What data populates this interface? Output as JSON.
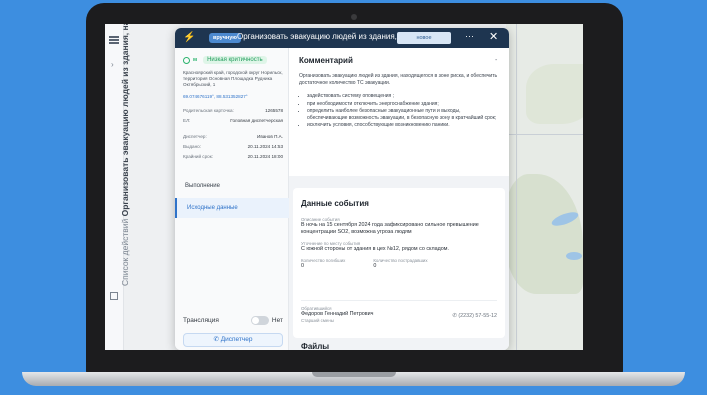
{
  "header": {
    "badge": "вручную",
    "title": "Организовать эвакуацию людей из здания, н...",
    "status": "новое",
    "more": "···",
    "close": "✕"
  },
  "rail": {
    "prefix": "Список действий",
    "title": "Организовать эвакуацию людей из здания, наход..."
  },
  "info": {
    "crit_num": "м",
    "criticality": "Низкая критичность",
    "address": "Красноярский край, городской округ Норильск, территория Основная Площадка Рудника Октябрьский, 1",
    "coords": "69.074676119°, 88.531352827°",
    "fields": [
      {
        "label": "Родительская карточка:",
        "value": "1265578"
      },
      {
        "label": "ЕЛ:",
        "value": "Головная диспетчерская"
      },
      {
        "label": "Диспетчер:",
        "value": "Иванов П.А."
      },
      {
        "label": "Выдано:",
        "value": "20.11.2024 14:53"
      },
      {
        "label": "Крайний срок:",
        "value": "20.11.2024 18:00"
      }
    ],
    "nav": [
      {
        "label": "Выполнение"
      },
      {
        "label": "Исходные данные"
      }
    ],
    "broadcast_label": "Трансляция",
    "broadcast_state": "Нет",
    "dispatcher_button": "Диспетчер"
  },
  "comment": {
    "heading": "Комментарий",
    "text": "Организовать эвакуацию людей из здания, находящегося в зоне риска, и обеспечить достаточное количество ТС эвакуации.",
    "items": [
      "задействовать систему оповещения ;",
      "при необходимости отключить энергоснабжение здания;",
      "определить наиболее безопасные эвакуационные пути и выходы, обеспечивающие возможность эвакуации, в безопасную зону в кратчайший срок;",
      "исключить условия, способствующие возникновению паники."
    ]
  },
  "event": {
    "heading": "Данные события",
    "desc_label": "Описание события",
    "desc": "В ночь на 15 сентября 2024 года зафиксировано сильное превышение концентрации SO2, возможна угроза людям",
    "place_label": "Уточнение по месту события",
    "place": "С южной стороны от здания в цех №12, рядом со складом.",
    "dead_label": "Количество погибших",
    "dead": "0",
    "injured_label": "Количество пострадавших",
    "injured": "0",
    "reporter_label": "Обратившийся",
    "reporter": "Федоров Геннадий Петрович",
    "reporter_role": "Старший смены",
    "phone": "(2232) 57-55-12"
  },
  "files_heading": "Файлы"
}
